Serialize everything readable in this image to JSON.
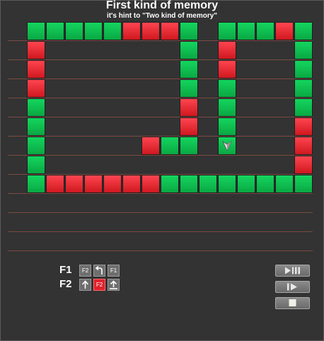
{
  "header": {
    "title": "First kind of memory",
    "subtitle": "it's hint to \"Two kind of memory\""
  },
  "colors": {
    "background": "#333333",
    "tile_green": "#0fbf50",
    "tile_red": "#e8222b",
    "grid_line": "#7a4a44"
  },
  "board": {
    "cols": 15,
    "rows": 9,
    "tiles": [
      {
        "c": 0,
        "r": 0,
        "color": "green"
      },
      {
        "c": 1,
        "r": 0,
        "color": "green"
      },
      {
        "c": 2,
        "r": 0,
        "color": "green"
      },
      {
        "c": 3,
        "r": 0,
        "color": "green"
      },
      {
        "c": 4,
        "r": 0,
        "color": "green"
      },
      {
        "c": 5,
        "r": 0,
        "color": "red"
      },
      {
        "c": 6,
        "r": 0,
        "color": "red"
      },
      {
        "c": 7,
        "r": 0,
        "color": "red"
      },
      {
        "c": 8,
        "r": 0,
        "color": "green"
      },
      {
        "c": 10,
        "r": 0,
        "color": "green"
      },
      {
        "c": 11,
        "r": 0,
        "color": "green"
      },
      {
        "c": 12,
        "r": 0,
        "color": "green"
      },
      {
        "c": 13,
        "r": 0,
        "color": "red"
      },
      {
        "c": 14,
        "r": 0,
        "color": "green"
      },
      {
        "c": 0,
        "r": 1,
        "color": "red"
      },
      {
        "c": 8,
        "r": 1,
        "color": "green"
      },
      {
        "c": 10,
        "r": 1,
        "color": "red"
      },
      {
        "c": 14,
        "r": 1,
        "color": "green"
      },
      {
        "c": 0,
        "r": 2,
        "color": "red"
      },
      {
        "c": 8,
        "r": 2,
        "color": "green"
      },
      {
        "c": 10,
        "r": 2,
        "color": "red"
      },
      {
        "c": 14,
        "r": 2,
        "color": "green"
      },
      {
        "c": 0,
        "r": 3,
        "color": "red"
      },
      {
        "c": 8,
        "r": 3,
        "color": "green"
      },
      {
        "c": 10,
        "r": 3,
        "color": "green"
      },
      {
        "c": 14,
        "r": 3,
        "color": "green"
      },
      {
        "c": 0,
        "r": 4,
        "color": "green"
      },
      {
        "c": 8,
        "r": 4,
        "color": "red"
      },
      {
        "c": 10,
        "r": 4,
        "color": "green"
      },
      {
        "c": 14,
        "r": 4,
        "color": "green"
      },
      {
        "c": 0,
        "r": 5,
        "color": "green"
      },
      {
        "c": 8,
        "r": 5,
        "color": "red"
      },
      {
        "c": 10,
        "r": 5,
        "color": "green"
      },
      {
        "c": 14,
        "r": 5,
        "color": "red"
      },
      {
        "c": 0,
        "r": 6,
        "color": "green"
      },
      {
        "c": 6,
        "r": 6,
        "color": "red"
      },
      {
        "c": 7,
        "r": 6,
        "color": "green"
      },
      {
        "c": 8,
        "r": 6,
        "color": "green"
      },
      {
        "c": 10,
        "r": 6,
        "color": "green"
      },
      {
        "c": 14,
        "r": 6,
        "color": "red"
      },
      {
        "c": 0,
        "r": 7,
        "color": "green"
      },
      {
        "c": 14,
        "r": 7,
        "color": "red"
      },
      {
        "c": 0,
        "r": 8,
        "color": "green"
      },
      {
        "c": 1,
        "r": 8,
        "color": "red"
      },
      {
        "c": 2,
        "r": 8,
        "color": "red"
      },
      {
        "c": 3,
        "r": 8,
        "color": "red"
      },
      {
        "c": 4,
        "r": 8,
        "color": "red"
      },
      {
        "c": 5,
        "r": 8,
        "color": "red"
      },
      {
        "c": 6,
        "r": 8,
        "color": "red"
      },
      {
        "c": 7,
        "r": 8,
        "color": "green"
      },
      {
        "c": 8,
        "r": 8,
        "color": "green"
      },
      {
        "c": 9,
        "r": 8,
        "color": "green"
      },
      {
        "c": 10,
        "r": 8,
        "color": "green"
      },
      {
        "c": 11,
        "r": 8,
        "color": "green"
      },
      {
        "c": 12,
        "r": 8,
        "color": "green"
      },
      {
        "c": 13,
        "r": 8,
        "color": "green"
      },
      {
        "c": 14,
        "r": 8,
        "color": "green"
      }
    ],
    "robot": {
      "c": 10,
      "r": 6,
      "facing": "down",
      "icon": "robot-arrow-icon"
    }
  },
  "program": {
    "functions": [
      {
        "name": "F1",
        "slots": [
          {
            "type": "call",
            "label": "F2",
            "color": "gray"
          },
          {
            "type": "turn-left",
            "icon": "turn-left-icon",
            "color": "gray"
          },
          {
            "type": "call",
            "label": "F1",
            "color": "gray"
          }
        ]
      },
      {
        "name": "F2",
        "slots": [
          {
            "type": "forward",
            "icon": "arrow-up-icon",
            "color": "gray"
          },
          {
            "type": "call",
            "label": "F2",
            "color": "red"
          },
          {
            "type": "paint",
            "icon": "paint-up-icon",
            "color": "gray"
          }
        ]
      }
    ]
  },
  "controls": [
    {
      "name": "play-pause-button",
      "icon": "play-pause-icon"
    },
    {
      "name": "step-button",
      "icon": "step-icon"
    },
    {
      "name": "stop-button",
      "icon": "stop-icon"
    }
  ]
}
